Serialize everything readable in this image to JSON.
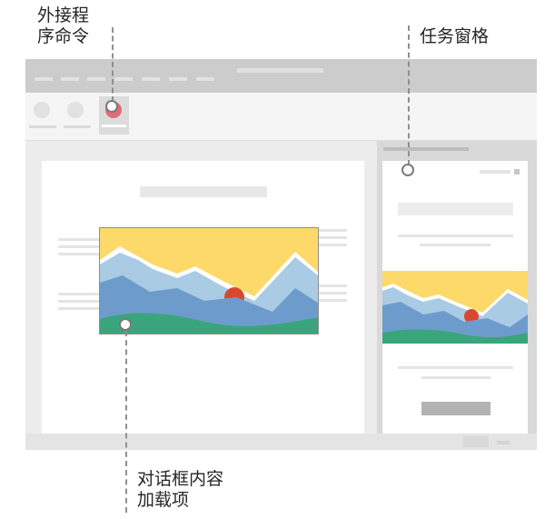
{
  "callouts": {
    "addin_commands": "外接程\n序命令",
    "task_pane": "任务窗格",
    "dialog_content": "对话框内容\n加载项"
  },
  "colors": {
    "sky": "#fdd96a",
    "sun": "#d8482f",
    "mountain_light": "#a9cbe3",
    "mountain_mid": "#6d9ccc",
    "hill_green": "#3aa57c",
    "addin_button": "#e06c78"
  },
  "icons": {
    "landscape": "mountain-sunset-image"
  }
}
